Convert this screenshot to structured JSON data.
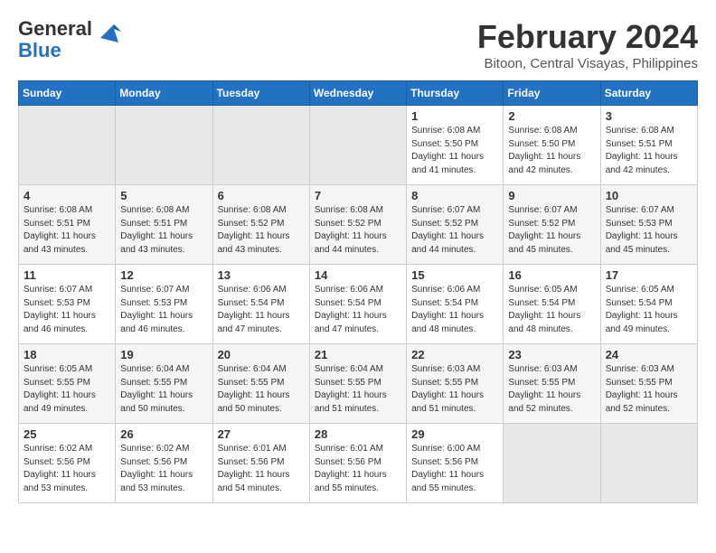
{
  "header": {
    "logo_general": "General",
    "logo_blue": "Blue",
    "month_year": "February 2024",
    "location": "Bitoon, Central Visayas, Philippines"
  },
  "days_of_week": [
    "Sunday",
    "Monday",
    "Tuesday",
    "Wednesday",
    "Thursday",
    "Friday",
    "Saturday"
  ],
  "weeks": [
    [
      {
        "day": "",
        "info": ""
      },
      {
        "day": "",
        "info": ""
      },
      {
        "day": "",
        "info": ""
      },
      {
        "day": "",
        "info": ""
      },
      {
        "day": "1",
        "info": "Sunrise: 6:08 AM\nSunset: 5:50 PM\nDaylight: 11 hours\nand 41 minutes."
      },
      {
        "day": "2",
        "info": "Sunrise: 6:08 AM\nSunset: 5:50 PM\nDaylight: 11 hours\nand 42 minutes."
      },
      {
        "day": "3",
        "info": "Sunrise: 6:08 AM\nSunset: 5:51 PM\nDaylight: 11 hours\nand 42 minutes."
      }
    ],
    [
      {
        "day": "4",
        "info": "Sunrise: 6:08 AM\nSunset: 5:51 PM\nDaylight: 11 hours\nand 43 minutes."
      },
      {
        "day": "5",
        "info": "Sunrise: 6:08 AM\nSunset: 5:51 PM\nDaylight: 11 hours\nand 43 minutes."
      },
      {
        "day": "6",
        "info": "Sunrise: 6:08 AM\nSunset: 5:52 PM\nDaylight: 11 hours\nand 43 minutes."
      },
      {
        "day": "7",
        "info": "Sunrise: 6:08 AM\nSunset: 5:52 PM\nDaylight: 11 hours\nand 44 minutes."
      },
      {
        "day": "8",
        "info": "Sunrise: 6:07 AM\nSunset: 5:52 PM\nDaylight: 11 hours\nand 44 minutes."
      },
      {
        "day": "9",
        "info": "Sunrise: 6:07 AM\nSunset: 5:52 PM\nDaylight: 11 hours\nand 45 minutes."
      },
      {
        "day": "10",
        "info": "Sunrise: 6:07 AM\nSunset: 5:53 PM\nDaylight: 11 hours\nand 45 minutes."
      }
    ],
    [
      {
        "day": "11",
        "info": "Sunrise: 6:07 AM\nSunset: 5:53 PM\nDaylight: 11 hours\nand 46 minutes."
      },
      {
        "day": "12",
        "info": "Sunrise: 6:07 AM\nSunset: 5:53 PM\nDaylight: 11 hours\nand 46 minutes."
      },
      {
        "day": "13",
        "info": "Sunrise: 6:06 AM\nSunset: 5:54 PM\nDaylight: 11 hours\nand 47 minutes."
      },
      {
        "day": "14",
        "info": "Sunrise: 6:06 AM\nSunset: 5:54 PM\nDaylight: 11 hours\nand 47 minutes."
      },
      {
        "day": "15",
        "info": "Sunrise: 6:06 AM\nSunset: 5:54 PM\nDaylight: 11 hours\nand 48 minutes."
      },
      {
        "day": "16",
        "info": "Sunrise: 6:05 AM\nSunset: 5:54 PM\nDaylight: 11 hours\nand 48 minutes."
      },
      {
        "day": "17",
        "info": "Sunrise: 6:05 AM\nSunset: 5:54 PM\nDaylight: 11 hours\nand 49 minutes."
      }
    ],
    [
      {
        "day": "18",
        "info": "Sunrise: 6:05 AM\nSunset: 5:55 PM\nDaylight: 11 hours\nand 49 minutes."
      },
      {
        "day": "19",
        "info": "Sunrise: 6:04 AM\nSunset: 5:55 PM\nDaylight: 11 hours\nand 50 minutes."
      },
      {
        "day": "20",
        "info": "Sunrise: 6:04 AM\nSunset: 5:55 PM\nDaylight: 11 hours\nand 50 minutes."
      },
      {
        "day": "21",
        "info": "Sunrise: 6:04 AM\nSunset: 5:55 PM\nDaylight: 11 hours\nand 51 minutes."
      },
      {
        "day": "22",
        "info": "Sunrise: 6:03 AM\nSunset: 5:55 PM\nDaylight: 11 hours\nand 51 minutes."
      },
      {
        "day": "23",
        "info": "Sunrise: 6:03 AM\nSunset: 5:55 PM\nDaylight: 11 hours\nand 52 minutes."
      },
      {
        "day": "24",
        "info": "Sunrise: 6:03 AM\nSunset: 5:55 PM\nDaylight: 11 hours\nand 52 minutes."
      }
    ],
    [
      {
        "day": "25",
        "info": "Sunrise: 6:02 AM\nSunset: 5:56 PM\nDaylight: 11 hours\nand 53 minutes."
      },
      {
        "day": "26",
        "info": "Sunrise: 6:02 AM\nSunset: 5:56 PM\nDaylight: 11 hours\nand 53 minutes."
      },
      {
        "day": "27",
        "info": "Sunrise: 6:01 AM\nSunset: 5:56 PM\nDaylight: 11 hours\nand 54 minutes."
      },
      {
        "day": "28",
        "info": "Sunrise: 6:01 AM\nSunset: 5:56 PM\nDaylight: 11 hours\nand 55 minutes."
      },
      {
        "day": "29",
        "info": "Sunrise: 6:00 AM\nSunset: 5:56 PM\nDaylight: 11 hours\nand 55 minutes."
      },
      {
        "day": "",
        "info": ""
      },
      {
        "day": "",
        "info": ""
      }
    ]
  ]
}
